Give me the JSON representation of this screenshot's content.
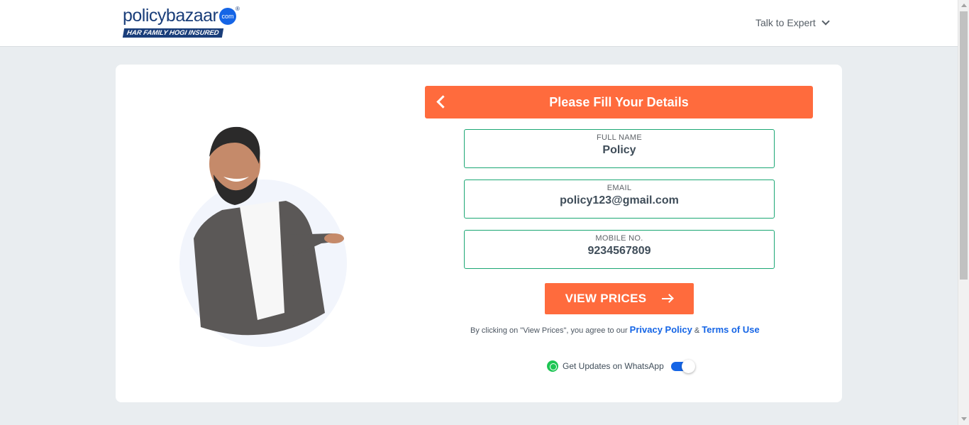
{
  "header": {
    "logo_text": "policybazaar",
    "logo_badge": "com",
    "logo_reg": "®",
    "logo_tagline": "HAR FAMILY HOGI INSURED",
    "talk_label": "Talk to Expert"
  },
  "form": {
    "title": "Please Fill Your Details",
    "full_name": {
      "label": "FULL NAME",
      "value": "Policy"
    },
    "email": {
      "label": "EMAIL",
      "value": "policy123@gmail.com"
    },
    "mobile": {
      "label": "MOBILE NO.",
      "value": "9234567809"
    },
    "submit_label": "VIEW PRICES",
    "consent_prefix": "By clicking on \"View Prices\", you agree to our",
    "privacy_label": "Privacy Policy",
    "consent_and": "&",
    "terms_label": "Terms of Use",
    "whatsapp_label": "Get Updates on WhatsApp",
    "whatsapp_enabled": true
  },
  "colors": {
    "brand_orange": "#ff6b3d",
    "brand_blue": "#1565e6",
    "field_border": "#1ba774",
    "whatsapp_green": "#1dc553"
  }
}
